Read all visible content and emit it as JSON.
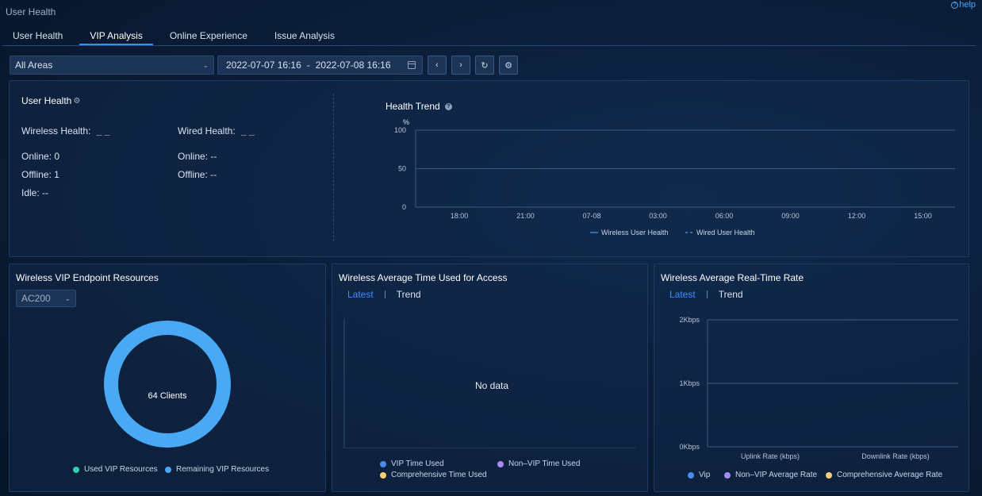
{
  "page": {
    "title": "User Health",
    "help": "help"
  },
  "tabs": [
    {
      "label": "User Health",
      "active": false
    },
    {
      "label": "VIP Analysis",
      "active": true
    },
    {
      "label": "Online Experience",
      "active": false
    },
    {
      "label": "Issue Analysis",
      "active": false
    }
  ],
  "toolbar": {
    "area": "All Areas",
    "date_start": "2022-07-07 16:16",
    "date_sep": "-",
    "date_end": "2022-07-08 16:16"
  },
  "user_health": {
    "title": "User Health",
    "wireless_label": "Wireless Health:",
    "wireless_value": "_ _",
    "wired_label": "Wired Health:",
    "wired_value": "_ _",
    "wireless_online": "Online: 0",
    "wireless_offline": "Offline: 1",
    "wireless_idle": "Idle: --",
    "wired_online": "Online: --",
    "wired_offline": "Offline: --"
  },
  "health_trend": {
    "title": "Health Trend",
    "chart_data": {
      "type": "line",
      "ylabel": "%",
      "ylim": [
        0,
        100
      ],
      "y_ticks": [
        "100",
        "50",
        "0"
      ],
      "x_ticks": [
        "18:00",
        "21:00",
        "07-08",
        "03:00",
        "06:00",
        "09:00",
        "12:00",
        "15:00"
      ],
      "series": [
        {
          "name": "Wireless User Health",
          "values": []
        },
        {
          "name": "Wired User Health",
          "values": []
        }
      ],
      "grid": true,
      "legend": "bottom"
    }
  },
  "vip_resources": {
    "title": "Wireless VIP Endpoint Resources",
    "device": "AC200",
    "center_label": "64 Clients",
    "chart_data": {
      "type": "pie",
      "categories": [
        "Used VIP Resources",
        "Remaining VIP Resources"
      ],
      "values": [
        0,
        64
      ],
      "colors": [
        "#2fd0b0",
        "#4aa9f5"
      ]
    }
  },
  "avg_time": {
    "title": "Wireless Average Time Used for Access",
    "tab_latest": "Latest",
    "tab_trend": "Trend",
    "no_data": "No data",
    "legend": [
      {
        "label": "VIP Time Used",
        "color": "#4a8cf0"
      },
      {
        "label": "Non–VIP Time Used",
        "color": "#a98af0"
      },
      {
        "label": "Comprehensive Time Used",
        "color": "#f5d27a"
      }
    ]
  },
  "avg_rate": {
    "title": "Wireless Average Real-Time Rate",
    "tab_latest": "Latest",
    "tab_trend": "Trend",
    "chart_data": {
      "type": "bar",
      "categories": [
        "Uplink Rate (kbps)",
        "Downlink Rate (kbps)"
      ],
      "y_ticks": [
        "2Kbps",
        "1Kbps",
        "0Kbps"
      ],
      "series": [
        {
          "name": "Vip",
          "values": [
            0,
            0
          ]
        },
        {
          "name": "Non–VIP Average Rate",
          "values": [
            0,
            0
          ]
        },
        {
          "name": "Comprehensive Average Rate",
          "values": [
            0,
            0
          ]
        }
      ]
    },
    "legend": [
      {
        "label": "Vip",
        "color": "#4a8cf0"
      },
      {
        "label": "Non–VIP Average Rate",
        "color": "#a98af0"
      },
      {
        "label": "Comprehensive Average Rate",
        "color": "#f5d27a"
      }
    ]
  },
  "colors": {
    "accent": "#3a8dff",
    "panel_border": "#1f3b62"
  }
}
